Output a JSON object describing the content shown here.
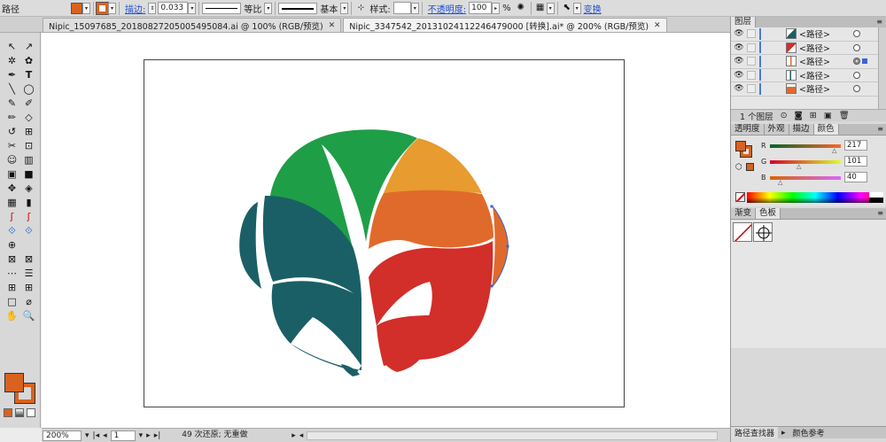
{
  "control_bar": {
    "object_type": "路径",
    "fill_color": "#d9621f",
    "stroke_label": "描边:",
    "stroke_weight": "0.033",
    "stroke_profile": "等比",
    "brush": "基本",
    "style_label": "样式:",
    "opacity_label": "不透明度:",
    "opacity_value": "100",
    "opacity_unit": "%",
    "transform_link": "变换"
  },
  "document_tabs": [
    {
      "label": "Nipic_15097685_20180827205005495084.ai @ 100% (RGB/预览)",
      "close": "✕",
      "active": false
    },
    {
      "label": "Nipic_3347542_20131024112246479000 [转换].ai* @ 200% (RGB/预览)",
      "close": "✕",
      "active": true
    }
  ],
  "tools": [
    "↖",
    "↗",
    "✲",
    "✿",
    "✒",
    "T",
    "╲",
    "◯",
    "✎",
    "✐",
    "✏",
    "◇",
    "↺",
    "⊞",
    "✂",
    "⊡",
    "☺",
    "▥",
    "▣",
    "■",
    "✥",
    "◈",
    "▦",
    "▮",
    "ʃ",
    "ʃ",
    "⟐",
    "⟐",
    "⊕",
    "",
    "⊠",
    "⊠",
    "⋯",
    "☰",
    "⊞",
    "⊞",
    "□",
    "⌀",
    "✋",
    "🔍"
  ],
  "status": {
    "zoom": "200%",
    "artboard": "1",
    "undo_text": "49 次还原; 无重做"
  },
  "layers_panel": {
    "tab": "图层",
    "rows": [
      {
        "name": "<路径>",
        "selected": false
      },
      {
        "name": "<路径>",
        "selected": false
      },
      {
        "name": "<路径>",
        "selected": true
      },
      {
        "name": "<路径>",
        "selected": false
      },
      {
        "name": "<路径>",
        "selected": false
      }
    ],
    "footer": "1 个图层"
  },
  "color_panel": {
    "tabs": [
      "透明度",
      "外观",
      "描边",
      "颜色"
    ],
    "active_tab": "颜色",
    "r_label": "R",
    "r_value": "217",
    "g_label": "G",
    "g_value": "101",
    "b_label": "B",
    "b_value": "40"
  },
  "gradient_panel": {
    "tabs": [
      "渐变",
      "色板"
    ],
    "active_tab": "色板"
  },
  "bottom_panel": {
    "tabs": [
      "路径查找器",
      "颜色参考"
    ]
  },
  "artwork_colors": {
    "green": "#1f9e48",
    "teal": "#1b5f66",
    "orange_light": "#e89b2e",
    "orange": "#e06a2b",
    "red": "#d22e2a",
    "selection": "#3b5fd6"
  }
}
